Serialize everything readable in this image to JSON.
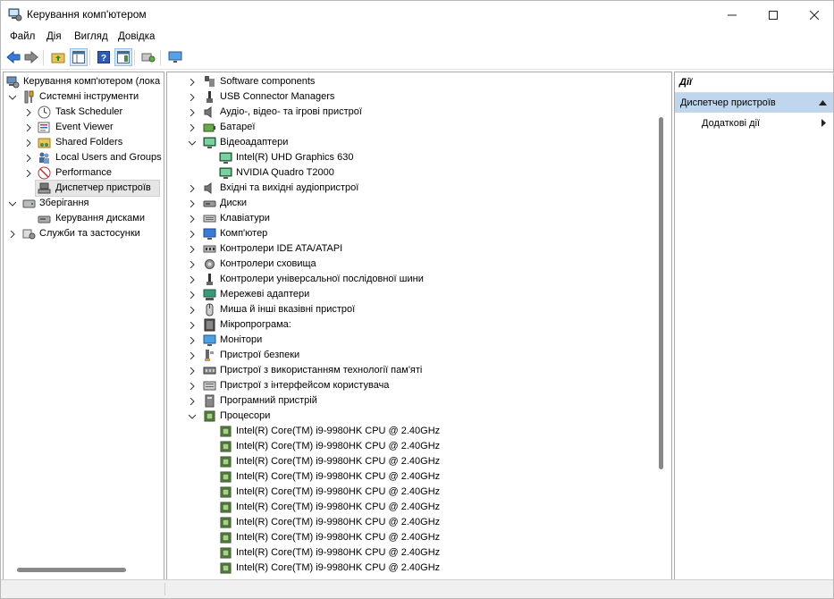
{
  "window": {
    "title": "Керування комп'ютером"
  },
  "menu": [
    "Файл",
    "Дія",
    "Вигляд",
    "Довідка"
  ],
  "toolbar": [
    "back-arrow-icon",
    "forward-arrow-icon",
    "up-folder-icon",
    "show-hide-tree-icon",
    "help-icon",
    "show-hide-action-icon",
    "properties-icon",
    "monitor-icon"
  ],
  "tree": {
    "root": "Керування комп'ютером (лока",
    "system_tools": "Системні інструменти",
    "task_scheduler": "Task Scheduler",
    "event_viewer": "Event Viewer",
    "shared_folders": "Shared Folders",
    "local_users": "Local Users and Groups",
    "performance": "Performance",
    "device_manager": "Диспетчер пристроїв",
    "storage": "Зберігання",
    "disk_management": "Керування дисками",
    "services": "Служби та застосунки"
  },
  "devices": [
    {
      "label": "Software components",
      "icon": "software-component-icon",
      "expanded": false,
      "level": 0
    },
    {
      "label": "USB Connector Managers",
      "icon": "usb-connector-icon",
      "expanded": false,
      "level": 0
    },
    {
      "label": "Аудіо-, відео- та ігрові пристрої",
      "icon": "speaker-icon",
      "expanded": false,
      "level": 0
    },
    {
      "label": "Батареї",
      "icon": "battery-icon",
      "expanded": false,
      "level": 0
    },
    {
      "label": "Відеоадаптери",
      "icon": "display-adapter-icon",
      "expanded": true,
      "level": 0
    },
    {
      "label": "Intel(R) UHD Graphics 630",
      "icon": "display-adapter-icon",
      "level": 1
    },
    {
      "label": "NVIDIA Quadro T2000",
      "icon": "display-adapter-icon",
      "level": 1
    },
    {
      "label": "Вхідні та вихідні аудіопристрої",
      "icon": "speaker-icon",
      "expanded": false,
      "level": 0
    },
    {
      "label": "Диски",
      "icon": "disk-drive-icon",
      "expanded": false,
      "level": 0
    },
    {
      "label": "Клавіатури",
      "icon": "keyboard-icon",
      "expanded": false,
      "level": 0
    },
    {
      "label": "Комп'ютер",
      "icon": "computer-icon",
      "expanded": false,
      "level": 0
    },
    {
      "label": "Контролери IDE ATA/ATAPI",
      "icon": "ide-controller-icon",
      "expanded": false,
      "level": 0
    },
    {
      "label": "Контролери сховища",
      "icon": "storage-controller-icon",
      "expanded": false,
      "level": 0
    },
    {
      "label": "Контролери універсальної послідовної шини",
      "icon": "usb-icon",
      "expanded": false,
      "level": 0
    },
    {
      "label": "Мережеві адаптери",
      "icon": "network-adapter-icon",
      "expanded": false,
      "level": 0
    },
    {
      "label": "Миша й інші вказівні пристрої",
      "icon": "mouse-icon",
      "expanded": false,
      "level": 0
    },
    {
      "label": "Мікропрограма:",
      "icon": "firmware-icon",
      "expanded": false,
      "level": 0
    },
    {
      "label": "Монітори",
      "icon": "monitor-icon",
      "expanded": false,
      "level": 0
    },
    {
      "label": "Пристрої безпеки",
      "icon": "security-key-icon",
      "expanded": false,
      "level": 0
    },
    {
      "label": "Пристрої з використанням технології пам'яті",
      "icon": "memory-device-icon",
      "expanded": false,
      "level": 0
    },
    {
      "label": "Пристрої з інтерфейсом користувача",
      "icon": "hid-icon",
      "expanded": false,
      "level": 0
    },
    {
      "label": "Програмний пристрій",
      "icon": "software-device-icon",
      "expanded": false,
      "level": 0
    },
    {
      "label": "Процесори",
      "icon": "processor-icon",
      "expanded": true,
      "level": 0
    },
    {
      "label": "Intel(R) Core(TM) i9-9980HK CPU @ 2.40GHz",
      "icon": "processor-icon",
      "level": 1
    },
    {
      "label": "Intel(R) Core(TM) i9-9980HK CPU @ 2.40GHz",
      "icon": "processor-icon",
      "level": 1
    },
    {
      "label": "Intel(R) Core(TM) i9-9980HK CPU @ 2.40GHz",
      "icon": "processor-icon",
      "level": 1
    },
    {
      "label": "Intel(R) Core(TM) i9-9980HK CPU @ 2.40GHz",
      "icon": "processor-icon",
      "level": 1
    },
    {
      "label": "Intel(R) Core(TM) i9-9980HK CPU @ 2.40GHz",
      "icon": "processor-icon",
      "level": 1
    },
    {
      "label": "Intel(R) Core(TM) i9-9980HK CPU @ 2.40GHz",
      "icon": "processor-icon",
      "level": 1
    },
    {
      "label": "Intel(R) Core(TM) i9-9980HK CPU @ 2.40GHz",
      "icon": "processor-icon",
      "level": 1
    },
    {
      "label": "Intel(R) Core(TM) i9-9980HK CPU @ 2.40GHz",
      "icon": "processor-icon",
      "level": 1
    },
    {
      "label": "Intel(R) Core(TM) i9-9980HK CPU @ 2.40GHz",
      "icon": "processor-icon",
      "level": 1
    },
    {
      "label": "Intel(R) Core(TM) i9-9980HK CPU @ 2.40GHz",
      "icon": "processor-icon",
      "level": 1
    }
  ],
  "actions": {
    "header": "Дії",
    "section": "Диспетчер пристроїв",
    "more": "Додаткові дії"
  },
  "colors": {
    "selection": "#e5e5e5",
    "actions_section": "#bfd6ee"
  }
}
